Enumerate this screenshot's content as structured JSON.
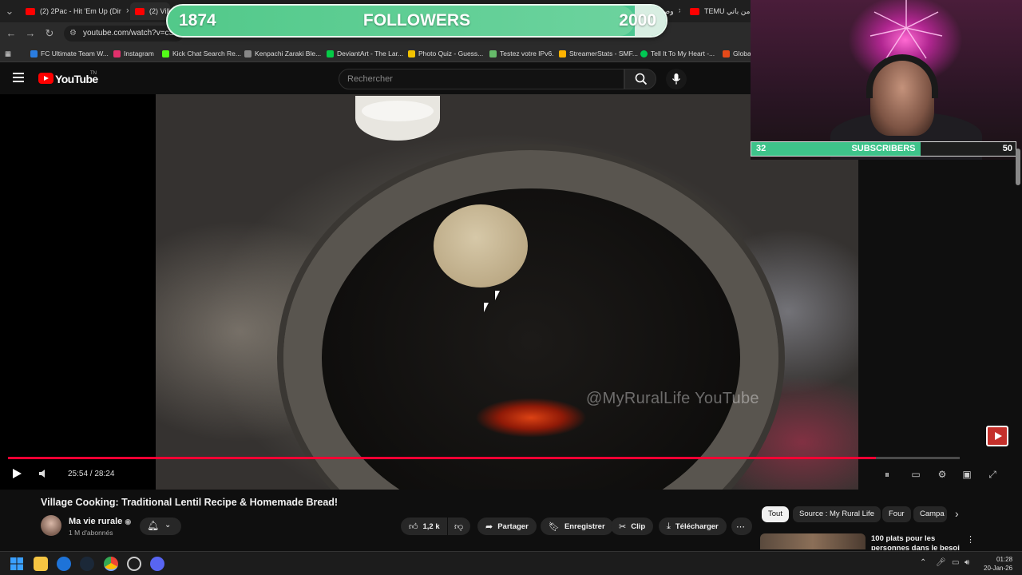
{
  "browser": {
    "tabs": [
      {
        "label": "(2) 2Pac - Hit 'Em Up (Dir",
        "active": false
      },
      {
        "label": "(2) Villa",
        "active": true
      },
      {
        "label": "(2) وصفة عتيقة",
        "active": false
      },
      {
        "label": "TEMU من باتي",
        "active": false
      }
    ],
    "url": "youtube.com/watch?v=cSu",
    "bookmarks": [
      {
        "label": "FC Ultimate Team W...",
        "color": "#2a7de1"
      },
      {
        "label": "Instagram",
        "color": "#e1306c"
      },
      {
        "label": "Kick Chat Search Re...",
        "color": "#53fc18"
      },
      {
        "label": "Kenpachi Zaraki Ble...",
        "color": "#888888"
      },
      {
        "label": "DeviantArt - The Lar...",
        "color": "#05cc47"
      },
      {
        "label": "Photo Quiz - Guess...",
        "color": "#f2c200"
      },
      {
        "label": "Testez votre IPv6.",
        "color": "#66bb6a"
      },
      {
        "label": "StreamerStats - SMF...",
        "color": "#ffb300"
      },
      {
        "label": "Tell It To My Heart -...",
        "color": "#00c853"
      },
      {
        "label": "Globa",
        "color": "#e64a19"
      }
    ]
  },
  "youtube": {
    "logo_text": "YouTube",
    "logo_sup": "TN",
    "search_placeholder": "Rechercher"
  },
  "player": {
    "watermark": "@MyRuralLife YouTube",
    "time": "25:54 / 28:24",
    "progress": 0.912
  },
  "video": {
    "title": "Village Cooking: Traditional Lentil Recipe & Homemade Bread!",
    "channel": "Ma vie rurale",
    "subscribers": "1 M d'abonnés",
    "likes": "1,2 k",
    "share": "Partager",
    "save": "Enregistrer",
    "clip": "Clip",
    "download": "Télécharger"
  },
  "chips": [
    "Tout",
    "Source : My Rural Life",
    "Four",
    "Campa"
  ],
  "recommendation": {
    "title": "100 plats pour les personnes dans le besoi"
  },
  "overlay": {
    "followers": {
      "current": "1874",
      "label": "FOLLOWERS",
      "goal": "2000",
      "progress": 0.937
    },
    "subscribers": {
      "current": "32",
      "label": "SUBSCRIBERS",
      "goal": "50",
      "progress": 0.64
    }
  },
  "taskbar": {
    "time": "01:28",
    "date": "20-Jan-26"
  }
}
